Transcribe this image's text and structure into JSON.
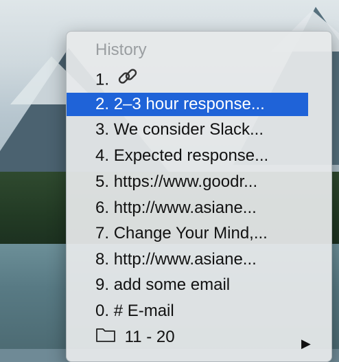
{
  "menu": {
    "header": "History",
    "items": [
      {
        "num": "1.",
        "text": "",
        "icon": "link-icon"
      },
      {
        "num": "2.",
        "text": "2–3 hour response...",
        "selected": true
      },
      {
        "num": "3.",
        "text": "We consider Slack..."
      },
      {
        "num": "4.",
        "text": "Expected response..."
      },
      {
        "num": "5.",
        "text": "https://www.goodr..."
      },
      {
        "num": "6.",
        "text": "http://www.asiane..."
      },
      {
        "num": "7.",
        "text": "Change Your Mind,..."
      },
      {
        "num": "8.",
        "text": "http://www.asiane..."
      },
      {
        "num": "9.",
        "text": "add some email"
      },
      {
        "num": "0.",
        "text": "# E-mail"
      }
    ],
    "submenu": {
      "label": "11 - 20",
      "icon": "folder-icon",
      "arrow": "▶"
    }
  },
  "colors": {
    "selection": "#1f63d8",
    "header_text": "#9a9ea1"
  }
}
